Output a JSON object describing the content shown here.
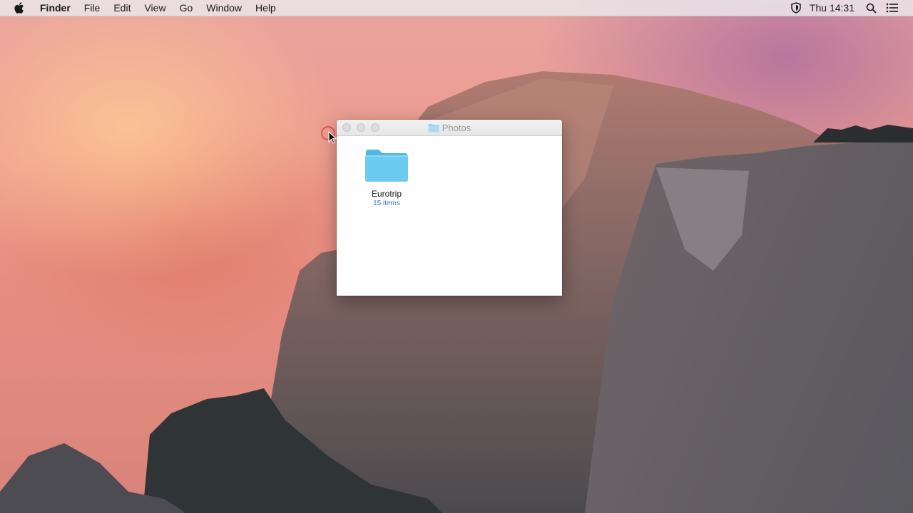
{
  "menubar": {
    "app_name": "Finder",
    "menus": [
      "File",
      "Edit",
      "View",
      "Go",
      "Window",
      "Help"
    ],
    "clock": "Thu 14:31",
    "status_icons": [
      "shield-icon",
      "search-icon",
      "list-icon"
    ]
  },
  "window": {
    "title": "Photos",
    "items": [
      {
        "name": "Eurotrip",
        "info": "15 items",
        "icon": "folder-icon"
      }
    ]
  },
  "colors": {
    "folder_blue": "#62c4ee",
    "count_blue": "#3a78d4"
  }
}
